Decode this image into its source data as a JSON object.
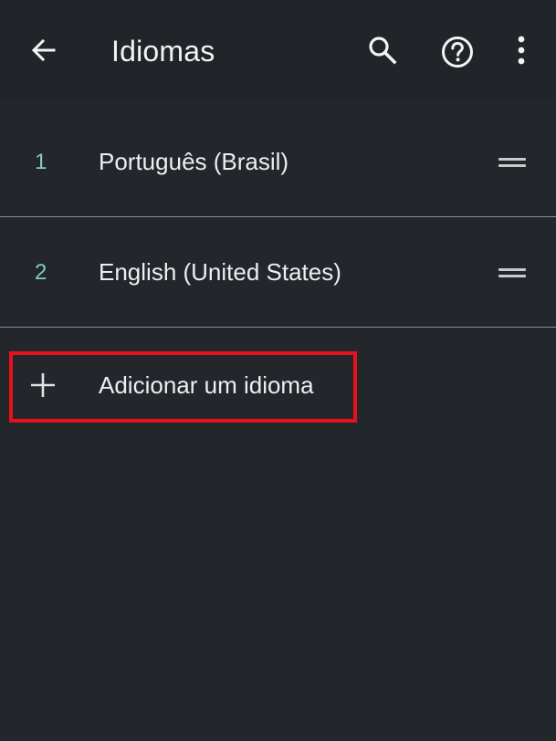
{
  "app_bar": {
    "title": "Idiomas",
    "back_icon": "arrow-back-icon",
    "search_icon": "search-icon",
    "help_icon": "help-circle-icon",
    "more_icon": "more-vert-icon"
  },
  "languages": [
    {
      "number": "1",
      "label": "Português (Brasil)"
    },
    {
      "number": "2",
      "label": "English (United States)"
    }
  ],
  "add_language": {
    "label": "Adicionar um idioma",
    "icon": "plus-icon"
  },
  "colors": {
    "background": "#23262b",
    "number_accent": "#7fcbc4",
    "highlight": "#e8101a"
  }
}
